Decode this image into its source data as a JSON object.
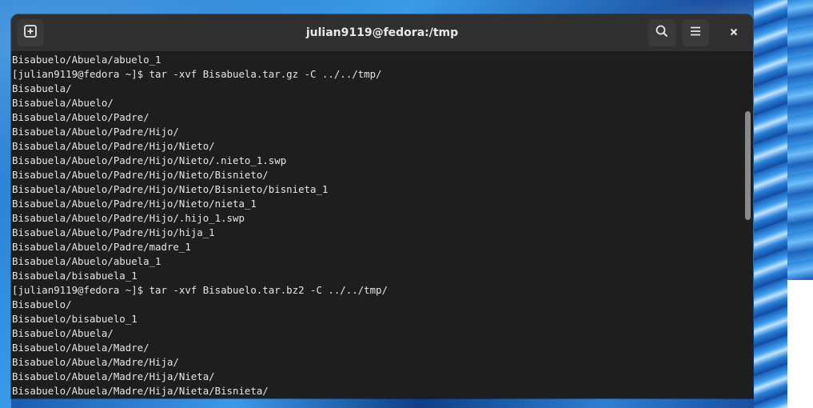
{
  "window": {
    "title": "julian9119@fedora:/tmp",
    "icons": {
      "new_tab": "new-tab-icon",
      "search": "search-icon",
      "menu": "hamburger-menu-icon",
      "close": "close-icon"
    }
  },
  "terminal": {
    "lines": [
      "Bisabuelo/Abuela/abuelo_1",
      "[julian9119@fedora ~]$ tar -xvf Bisabuela.tar.gz -C ../../tmp/",
      "Bisabuela/",
      "Bisabuela/Abuelo/",
      "Bisabuela/Abuelo/Padre/",
      "Bisabuela/Abuelo/Padre/Hijo/",
      "Bisabuela/Abuelo/Padre/Hijo/Nieto/",
      "Bisabuela/Abuelo/Padre/Hijo/Nieto/.nieto_1.swp",
      "Bisabuela/Abuelo/Padre/Hijo/Nieto/Bisnieto/",
      "Bisabuela/Abuelo/Padre/Hijo/Nieto/Bisnieto/bisnieta_1",
      "Bisabuela/Abuelo/Padre/Hijo/Nieto/nieta_1",
      "Bisabuela/Abuelo/Padre/Hijo/.hijo_1.swp",
      "Bisabuela/Abuelo/Padre/Hijo/hija_1",
      "Bisabuela/Abuelo/Padre/madre_1",
      "Bisabuela/Abuelo/abuela_1",
      "Bisabuela/bisabuela_1",
      "[julian9119@fedora ~]$ tar -xvf Bisabuelo.tar.bz2 -C ../../tmp/",
      "Bisabuelo/",
      "Bisabuelo/bisabuelo_1",
      "Bisabuelo/Abuela/",
      "Bisabuelo/Abuela/Madre/",
      "Bisabuelo/Abuela/Madre/Hija/",
      "Bisabuelo/Abuela/Madre/Hija/Nieta/",
      "Bisabuelo/Abuela/Madre/Hija/Nieta/Bisnieta/"
    ]
  },
  "colors": {
    "headerbar": "#303030",
    "terminal_bg": "#1e1e1e",
    "terminal_fg": "#e6e6e6",
    "button_bg": "#3a3a3a"
  }
}
